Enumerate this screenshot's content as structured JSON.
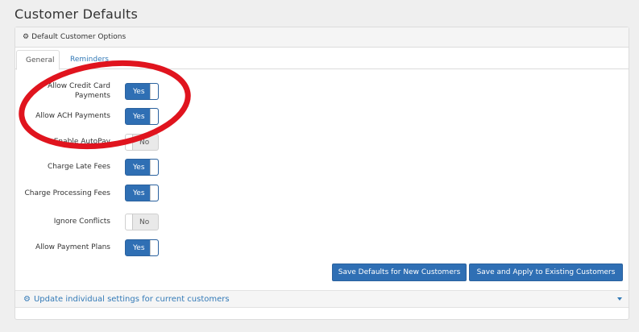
{
  "page": {
    "title": "Customer Defaults"
  },
  "panel": {
    "heading": "Default Customer Options"
  },
  "tabs": [
    {
      "label": "General",
      "active": true
    },
    {
      "label": "Reminders",
      "active": false
    }
  ],
  "settings": [
    {
      "label": "Allow Credit Card Payments",
      "value": "Yes",
      "on": true
    },
    {
      "label": "Allow ACH Payments",
      "value": "Yes",
      "on": true
    },
    {
      "label": "Enable AutoPay",
      "value": "No",
      "on": false
    },
    {
      "label": "Charge Late Fees",
      "value": "Yes",
      "on": true
    },
    {
      "label": "Charge Processing Fees",
      "value": "Yes",
      "on": true
    },
    {
      "label": "Ignore Conflicts",
      "value": "No",
      "on": false
    },
    {
      "label": "Allow Payment Plans",
      "value": "Yes",
      "on": true
    }
  ],
  "actions": {
    "save_defaults": "Save Defaults for New Customers",
    "save_apply": "Save and Apply to Existing Customers"
  },
  "collapse": {
    "label": "Update individual settings for current customers"
  },
  "colors": {
    "primary": "#2f6fb4",
    "link": "#337ab7",
    "annotation": "#e0141e"
  }
}
